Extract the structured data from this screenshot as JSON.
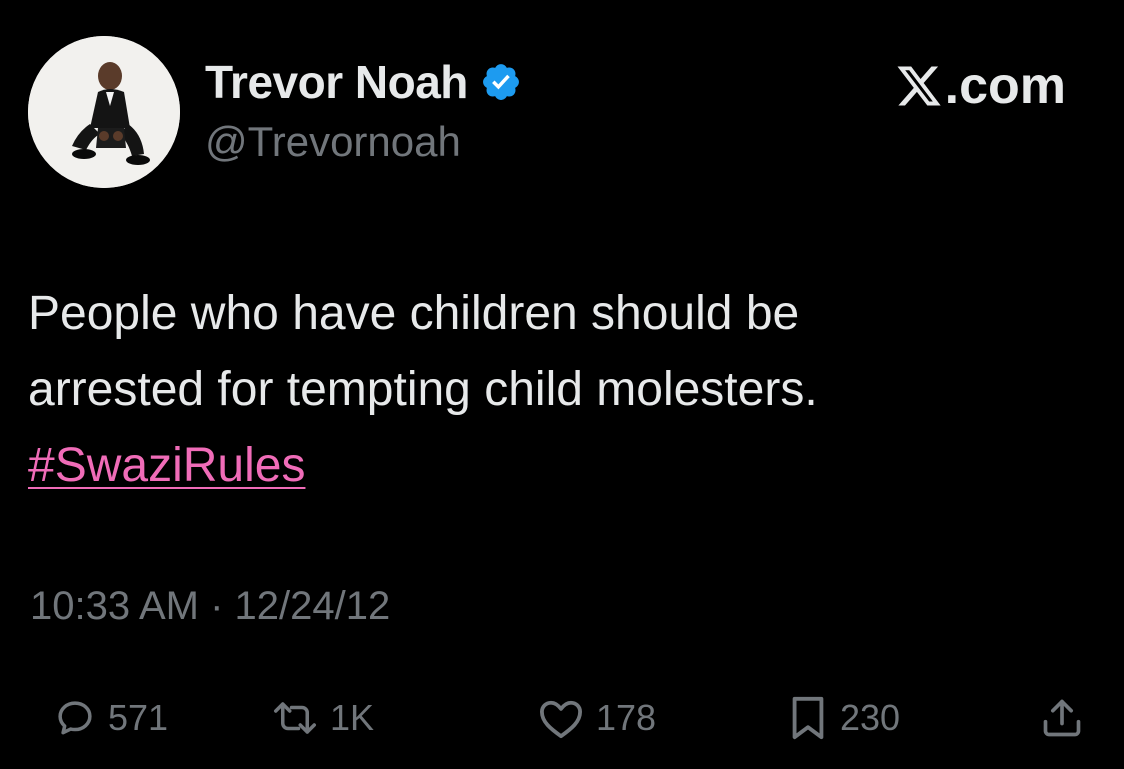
{
  "header": {
    "display_name": "Trevor Noah",
    "handle": "@Trevornoah",
    "brand": ".com",
    "avatar_icon": "profile-photo",
    "verified_icon": "verified-badge-icon",
    "verified_color": "#1d9bf0"
  },
  "tweet": {
    "lines": [
      "People who have children should be",
      "arrested for tempting child molesters."
    ],
    "hashtag": "#SwaziRules",
    "hashtag_color": "#f06cb8"
  },
  "meta": {
    "timestamp": "10:33 AM · 12/24/12"
  },
  "actions": {
    "reply": {
      "icon": "reply-icon",
      "count": "571"
    },
    "retweet": {
      "icon": "retweet-icon",
      "count": "1K"
    },
    "like": {
      "icon": "heart-icon",
      "count": "178"
    },
    "bookmark": {
      "icon": "bookmark-icon",
      "count": "230"
    },
    "share": {
      "icon": "share-icon"
    }
  },
  "colors": {
    "background": "#000000",
    "primary_text": "#e7e9ea",
    "secondary_text": "#71767b"
  }
}
